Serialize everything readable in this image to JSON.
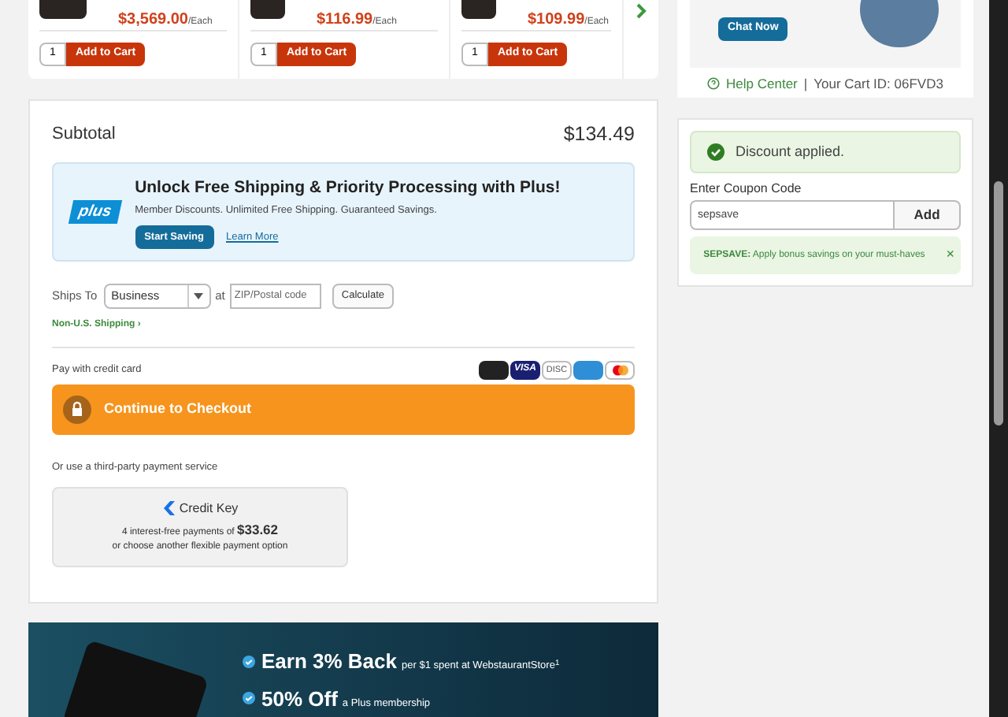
{
  "products": [
    {
      "price": "$3,569.00",
      "unit": "/Each",
      "qty": "1",
      "button": "Add to Cart"
    },
    {
      "price": "$116.99",
      "unit": "/Each",
      "qty": "1",
      "button": "Add to Cart"
    },
    {
      "price": "$109.99",
      "unit": "/Each",
      "qty": "1",
      "button": "Add to Cart"
    }
  ],
  "support": {
    "chat_button": "Chat Now",
    "help_center": "Help Center",
    "separator": "|",
    "cart_id": "Your Cart ID: 06FVD3"
  },
  "summary": {
    "subtotal_label": "Subtotal",
    "subtotal": "$134.49",
    "plus": {
      "logo": "plus",
      "title": "Unlock Free Shipping & Priority Processing with Plus!",
      "subtitle": "Member Discounts. Unlimited Free Shipping. Guaranteed Savings.",
      "primary_button": "Start Saving",
      "link": "Learn More"
    },
    "shipping": {
      "label": "Ships To",
      "type": "Business",
      "at": "at",
      "zip_placeholder": "ZIP/Postal code",
      "button": "Calculate",
      "non_us_link": "Non-U.S. Shipping ›"
    },
    "credit_card_label": "Pay with credit card",
    "cards": [
      {
        "kind": "store"
      },
      {
        "kind": "visa",
        "text": "VISA"
      },
      {
        "kind": "discover",
        "text": "DISC"
      },
      {
        "kind": "amex"
      },
      {
        "kind": "mastercard"
      }
    ],
    "checkout_button": "Continue to Checkout",
    "third_party_label": "Or use a third-party payment service",
    "credit_key": {
      "name": "Credit Key",
      "line1": "4 interest-free payments of **$33.62**",
      "line2": "or choose another flexible payment option"
    }
  },
  "coupon": {
    "status": "Discount applied.",
    "label": "Enter Coupon Code",
    "value": "sepsave",
    "button": "Add",
    "applied_code": "SEPSAVE:",
    "applied_text": "Apply bonus savings on your must-haves",
    "dismiss": "×"
  },
  "promo": {
    "items": [
      {
        "headline": "Earn 3% Back",
        "detail": "per $1 spent at WebstaurantStore$^{1}$"
      },
      {
        "headline": "50% Off",
        "detail": "a Plus membership"
      }
    ]
  }
}
